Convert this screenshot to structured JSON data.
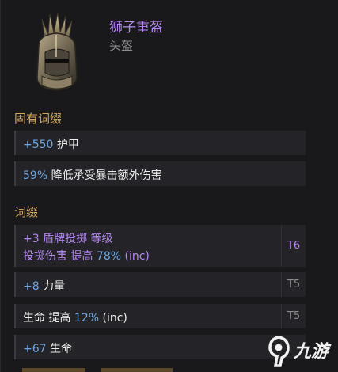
{
  "item": {
    "name": "狮子重盔",
    "type": "头盔"
  },
  "sections": {
    "inherent_title": "固有词缀",
    "affix_title": "词缀"
  },
  "inherent": [
    {
      "value": "+550",
      "text": " 护甲"
    },
    {
      "value": "59%",
      "text": " 降低承受暴击额外伤害"
    }
  ],
  "affixes": [
    {
      "line1": "+3 盾牌投掷 等级",
      "line2a": "投掷伤害 提高 ",
      "line2b": "78%",
      "line2c": " (inc)",
      "tier": "T6"
    },
    {
      "value": "+8",
      "text": " 力量",
      "tier": "T5"
    },
    {
      "pre": "生命 提高 ",
      "value": "12%",
      "text": " (inc)",
      "tier": "T5"
    },
    {
      "value": "+67",
      "text": " 生命"
    }
  ],
  "watermark": {
    "text": "九游"
  },
  "colors": {
    "name_purple": "#b488f0",
    "section_gold": "#d3a75c",
    "value_blue": "#6fa6e0"
  }
}
